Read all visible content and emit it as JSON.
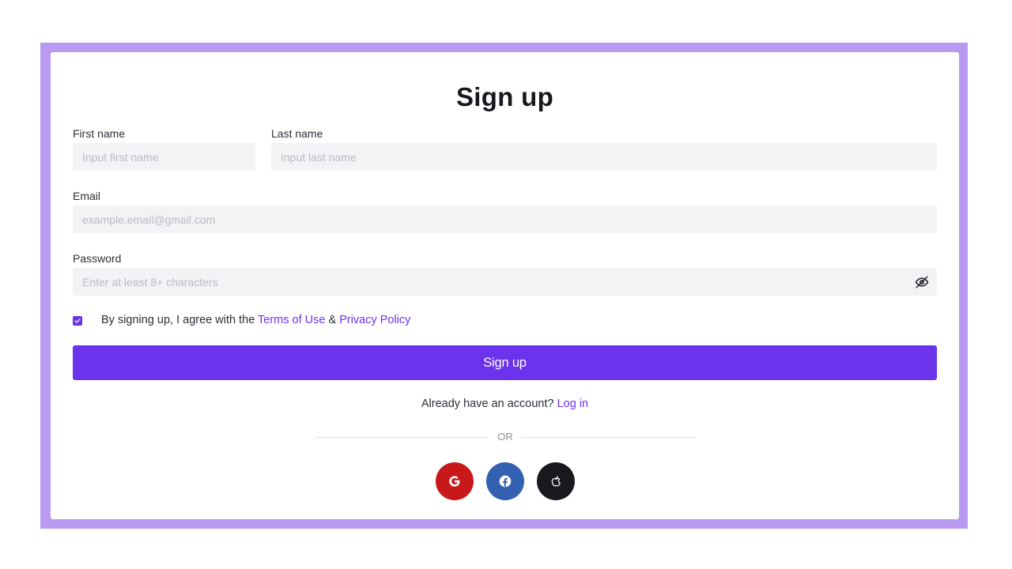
{
  "form": {
    "title": "Sign up",
    "first_name": {
      "label": "First name",
      "placeholder": "Input first name"
    },
    "last_name": {
      "label": "Last name",
      "placeholder": "Input last name"
    },
    "email": {
      "label": "Email",
      "placeholder": "example.email@gmail.com"
    },
    "password": {
      "label": "Password",
      "placeholder": "Enter at least 8+ characters",
      "toggle_icon": "eye-off-icon"
    },
    "agreement": {
      "checked": true,
      "text": "By signing up, I agree with the ",
      "terms_link": "Terms of Use",
      "separator": " & ",
      "privacy_link": "Privacy Policy"
    },
    "submit_label": "Sign up",
    "login_prompt": "Already have an account? ",
    "login_link": "Log in",
    "divider_text": "OR"
  },
  "social": [
    {
      "name": "google",
      "icon": "google-icon",
      "color": "#c8191a"
    },
    {
      "name": "facebook",
      "icon": "facebook-icon",
      "color": "#3360b0"
    },
    {
      "name": "apple",
      "icon": "apple-icon",
      "color": "#17191c"
    }
  ],
  "colors": {
    "accent": "#6c33ec",
    "frame": "#b89af1",
    "input_bg": "#f2f3f5"
  }
}
